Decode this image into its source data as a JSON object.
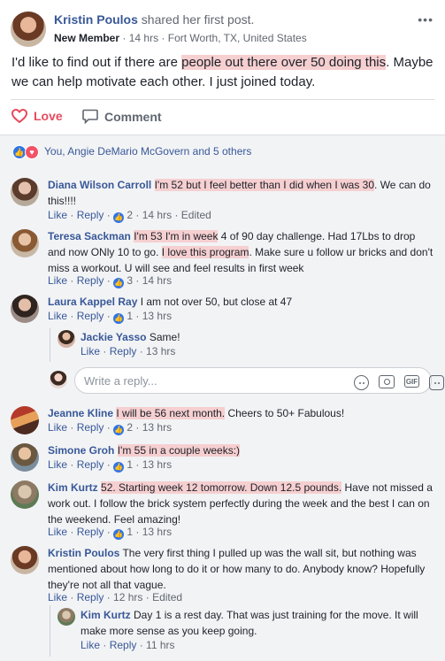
{
  "post": {
    "author": "Kristin Poulos",
    "action_text": "shared her first post.",
    "badge": "New Member",
    "time": "14 hrs",
    "location": "Fort Worth, TX, United States",
    "text_pre": "I'd like to find out if there are ",
    "text_hl": "people out there over 50 doing this",
    "text_post": ". Maybe we can help motivate each other. I just joined today.",
    "more_icon": "more-horizontal-icon"
  },
  "actions": {
    "love_label": "Love",
    "comment_label": "Comment"
  },
  "reactions": {
    "summary": "You, Angie DeMario McGovern and 5 others",
    "icons": [
      "like-icon",
      "love-icon"
    ]
  },
  "labels": {
    "like": "Like",
    "reply": "Reply",
    "sep": " · ",
    "edited": "Edited"
  },
  "comments": [
    {
      "name": "Diana Wilson Carroll",
      "text_pre": "",
      "text_hl": "I'm 52 but I feel better than I did when I was 30",
      "text_post": ". We can do this!!!!",
      "likes": "2",
      "time": "14 hrs"
    },
    {
      "name": "Teresa Sackman",
      "text_pre": "",
      "text_hl": "I'm 53 I'm in week",
      "text_mid": " 4 of 90 day challenge. Had 17Lbs to drop and now ONly 10 to go. ",
      "text_hl2": "I love this program",
      "text_post": ". Make sure u follow ur bricks and don't miss a workout. U will see and feel results in first week",
      "likes": "3",
      "time": "14 hrs"
    },
    {
      "name": "Laura Kappel Ray",
      "text": "I am not over 50, but close at 47",
      "likes": "1",
      "time": "13 hrs"
    },
    {
      "name": "Jeanne Kline",
      "text_pre": "",
      "text_hl": "I will be 56 next month.",
      "text_post": " Cheers to 50+ Fabulous!",
      "likes": "2",
      "time": "13 hrs"
    },
    {
      "name": "Simone Groh",
      "text_pre": "",
      "text_hl": "I'm 55 in a couple weeks:)",
      "text_post": "",
      "likes": "1",
      "time": "13 hrs"
    },
    {
      "name": "Kim Kurtz",
      "text_pre": "",
      "text_hl": "52. Starting week 12 tomorrow. Down 12.5 pounds.",
      "text_post": " Have not missed a work out. I follow the brick system perfectly during the week and the best I can on the weekend. Feel amazing!",
      "likes": "1",
      "time": "13 hrs"
    },
    {
      "name": "Kristin Poulos",
      "text": "The very first thing I pulled up was the wall sit, but nothing was mentioned about how long to do it or how many to do. Anybody know? Hopefully they're not all that vague.",
      "time": "12 hrs"
    }
  ],
  "replies": [
    {
      "name": "Jackie Yasso",
      "text": "Same!",
      "time": "13 hrs"
    },
    {
      "name": "Kim Kurtz",
      "text": "Day 1 is a rest day. That was just training for the move. It will make more sense as you keep going.",
      "time": "11 hrs"
    }
  ],
  "reply_input": {
    "placeholder": "Write a reply...",
    "icons": [
      "emoji-icon",
      "camera-icon",
      "gif-icon",
      "sticker-icon"
    ],
    "gif_label": "GIF"
  },
  "colors": {
    "link": "#385898",
    "highlight": "#f6cfd0",
    "love": "#e64a5d",
    "like_blue": "#2f74e8",
    "panel_bg": "#f2f3f5"
  }
}
